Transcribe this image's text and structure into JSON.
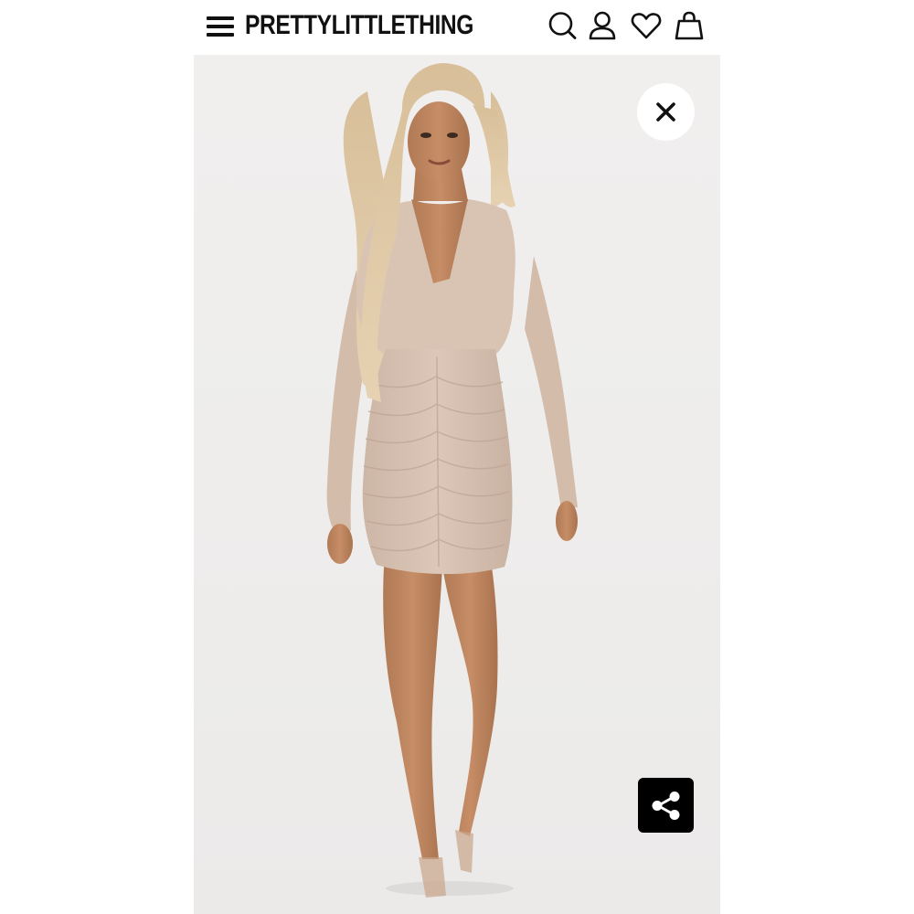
{
  "header": {
    "brand": "PRETTYLITTLETHING",
    "icons": [
      "menu-icon",
      "search-icon",
      "account-icon",
      "wishlist-heart-icon",
      "shopping-bag-icon"
    ]
  },
  "product_image": {
    "icons": [
      "close-icon",
      "share-icon"
    ]
  },
  "colors": {
    "text": "#111111",
    "background": "#ffffff",
    "image_background": "#eeedec",
    "dress": "#d8c3b4",
    "share_button": "#000000",
    "close_button": "#ffffff"
  }
}
